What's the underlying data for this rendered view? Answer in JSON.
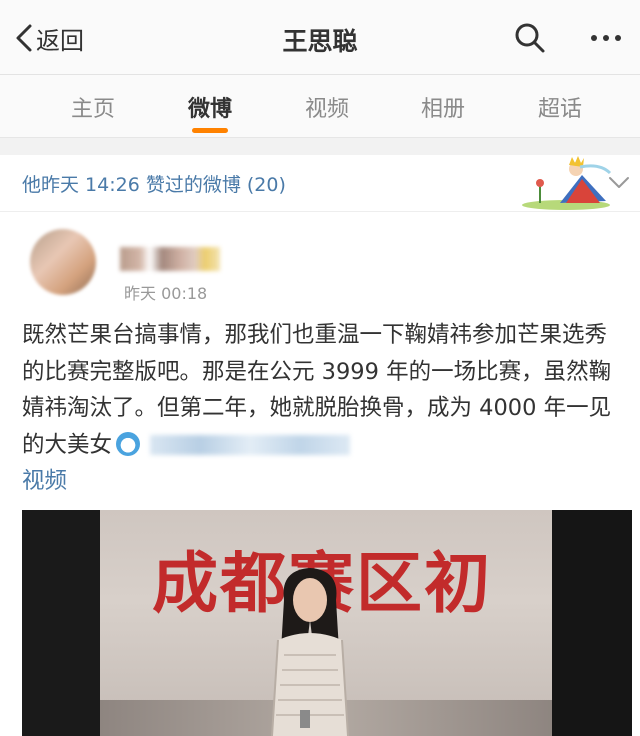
{
  "header": {
    "back_label": "返回",
    "title": "王思聪"
  },
  "tabs": [
    {
      "label": "主页",
      "active": false
    },
    {
      "label": "微博",
      "active": true
    },
    {
      "label": "视频",
      "active": false
    },
    {
      "label": "相册",
      "active": false
    },
    {
      "label": "超话",
      "active": false
    }
  ],
  "liked": {
    "text": "他昨天 14:26 赞过的微博 (20)"
  },
  "post": {
    "time": "昨天 00:18",
    "body_text": "既然芒果台搞事情，那我们也重温一下鞠婧祎参加芒果选秀的比赛完整版吧。那是在公元 3999 年的一场比赛，虽然鞠婧祎淘汰了。但第二年，她就脱胎换骨，成为 4000 年一见的大美女",
    "video_link_label": "视频",
    "video_caption": "成都赛区初"
  },
  "colors": {
    "accent": "#ff8200",
    "link": "#4a7aa8",
    "caption_red": "#c22b2b"
  },
  "icons": [
    "back-chevron-icon",
    "search-icon",
    "more-icon",
    "little-prince-icon",
    "collapse-chevron-icon",
    "emoji-icon"
  ]
}
